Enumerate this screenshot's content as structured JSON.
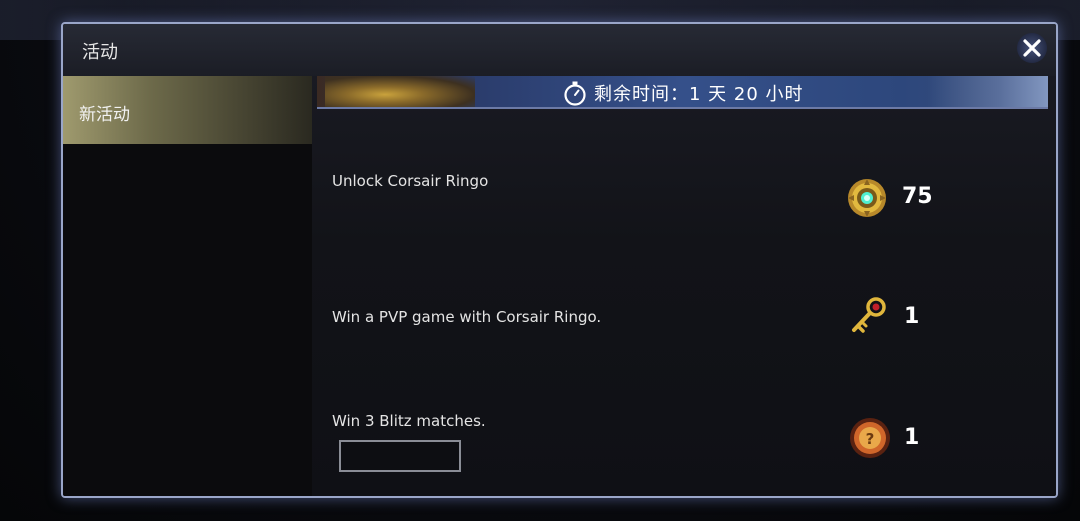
{
  "window": {
    "title": "活动"
  },
  "sidebar": {
    "items": [
      {
        "label": "新活动"
      }
    ]
  },
  "banner": {
    "time_remaining": "剩余时间：1 天 20 小时"
  },
  "tasks": [
    {
      "label": "Unlock Corsair Ringo",
      "reward_icon": "gold-medallion-icon",
      "reward_count": "75"
    },
    {
      "label": "Win a PVP game with Corsair Ringo.",
      "reward_icon": "golden-key-icon",
      "reward_count": "1"
    },
    {
      "label": "Win 3 Blitz matches.",
      "reward_icon": "mystery-orb-icon",
      "reward_count": "1"
    }
  ],
  "colors": {
    "accent_border": "#9aa6c9",
    "sidebar_selected": "#9f9a6e",
    "gold": "#d9b23a"
  }
}
